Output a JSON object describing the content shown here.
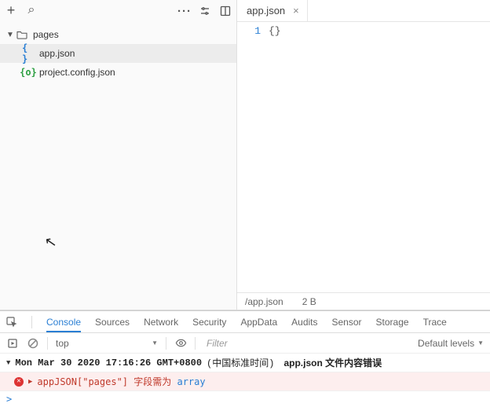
{
  "explorer": {
    "folder": {
      "label": "pages",
      "expanded": true
    },
    "files": [
      {
        "label": "app.json",
        "icon": "json-blue",
        "active": true
      },
      {
        "label": "project.config.json",
        "icon": "json-green",
        "active": false
      }
    ]
  },
  "editor": {
    "tab": {
      "label": "app.json"
    },
    "line_number": "1",
    "code": "{}",
    "status": {
      "path": "/app.json",
      "size": "2 B"
    }
  },
  "devtools": {
    "tabs": [
      "Console",
      "Sources",
      "Network",
      "Security",
      "AppData",
      "Audits",
      "Sensor",
      "Storage",
      "Trace"
    ],
    "active_tab": "Console",
    "context": "top",
    "filter_placeholder": "Filter",
    "levels_label": "Default levels",
    "log": {
      "timestamp": "Mon Mar 30 2020 17:16:26 GMT+0800",
      "timezone": "(中国标准时间)",
      "source": "app.json 文件内容错误"
    },
    "error": {
      "prefix": "appJSON[\"pages\"] 字段需为 ",
      "type": "array"
    },
    "prompt": ">"
  },
  "colors": {
    "accent_blue": "#2a7fd4",
    "error_red": "#c0392b",
    "json_green": "#2ea043"
  }
}
